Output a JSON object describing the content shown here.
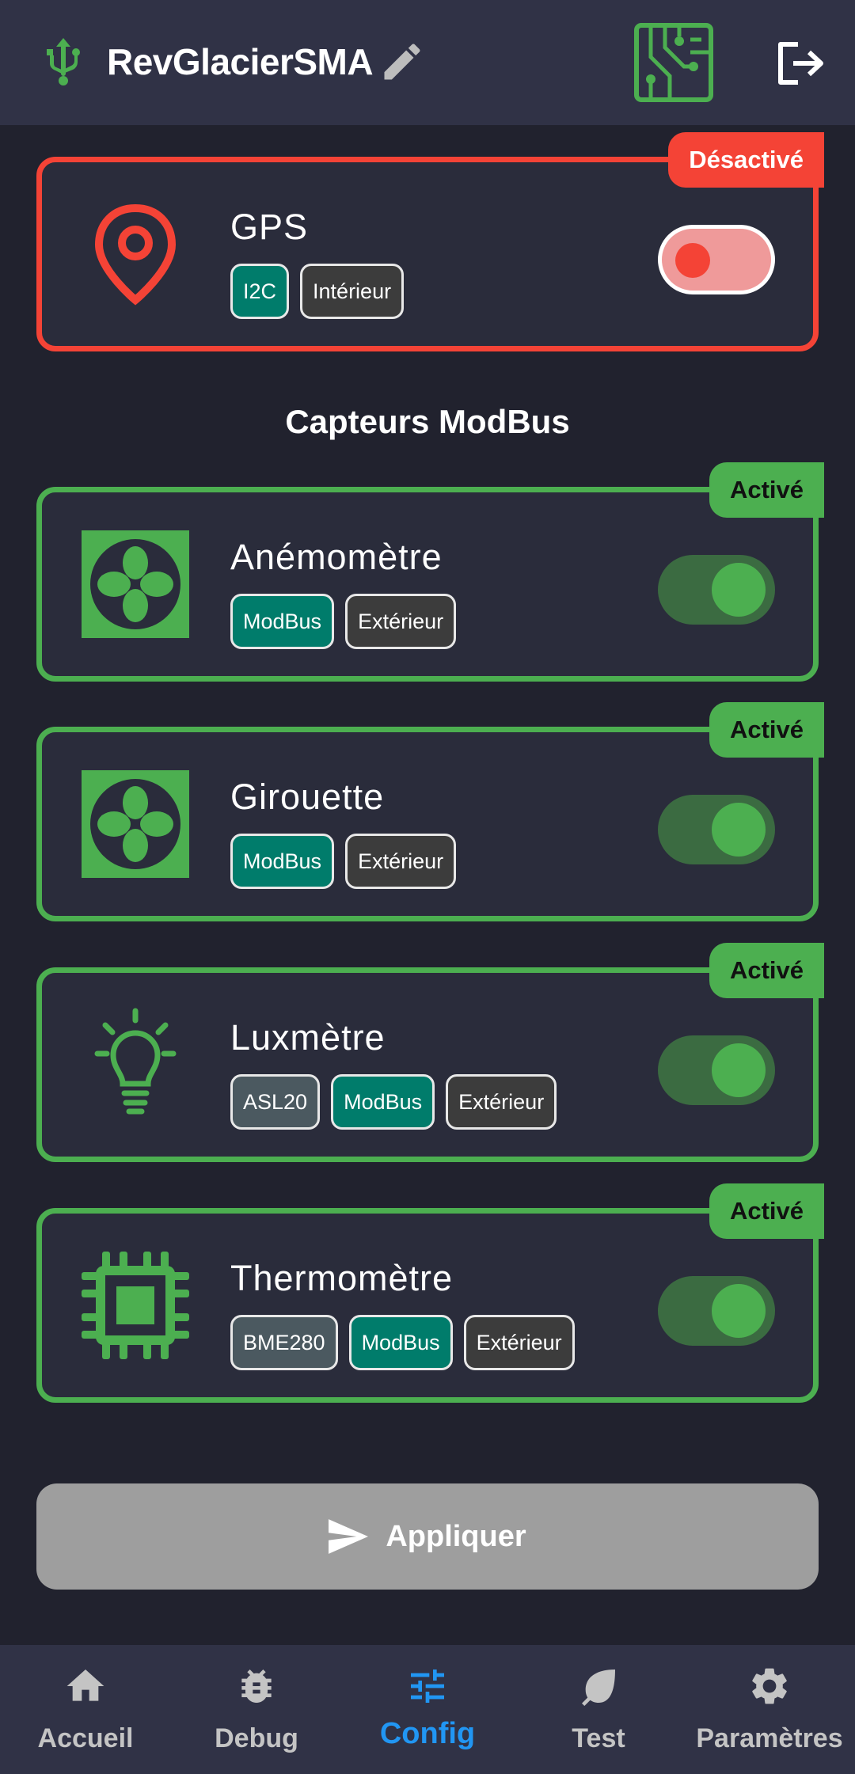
{
  "appbar": {
    "title": "RevGlacierSMA"
  },
  "gps_card": {
    "name": "GPS",
    "status": "Désactivé",
    "enabled": false,
    "icon": "location-pin-icon",
    "chips": [
      "I2C",
      "Intérieur"
    ]
  },
  "section": {
    "title": "Capteurs ModBus"
  },
  "sensors": [
    {
      "name": "Anémomètre",
      "status": "Activé",
      "enabled": true,
      "icon": "fan-icon",
      "chips": [
        "ModBus",
        "Extérieur"
      ]
    },
    {
      "name": "Girouette",
      "status": "Activé",
      "enabled": true,
      "icon": "fan-icon",
      "chips": [
        "ModBus",
        "Extérieur"
      ]
    },
    {
      "name": "Luxmètre",
      "status": "Activé",
      "enabled": true,
      "icon": "lightbulb-icon",
      "chips": [
        "ASL20",
        "ModBus",
        "Extérieur"
      ]
    },
    {
      "name": "Thermomètre",
      "status": "Activé",
      "enabled": true,
      "icon": "chip-icon",
      "chips": [
        "BME280",
        "ModBus",
        "Extérieur"
      ]
    }
  ],
  "apply": {
    "label": "Appliquer"
  },
  "nav": [
    {
      "label": "Accueil",
      "icon": "home-icon"
    },
    {
      "label": "Debug",
      "icon": "bug-icon"
    },
    {
      "label": "Config",
      "icon": "sliders-icon",
      "active": true
    },
    {
      "label": "Test",
      "icon": "leaf-icon"
    },
    {
      "label": "Paramètres",
      "icon": "gear-icon"
    }
  ],
  "colors": {
    "active": "#4caf50",
    "inactive": "#f44336",
    "accent": "#2196f3",
    "teal_chip": "#007c6b"
  }
}
